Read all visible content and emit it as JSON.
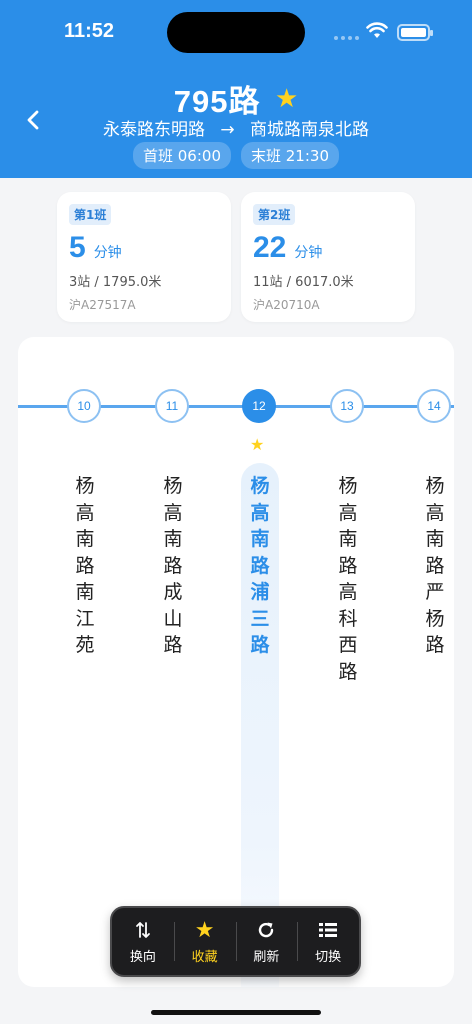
{
  "status": {
    "time": "11:52"
  },
  "header": {
    "route": "795路",
    "origin": "永泰路东明路",
    "arrow": "→",
    "destination": "商城路南泉北路",
    "first_bus": "首班 06:00",
    "last_bus": "末班 21:30"
  },
  "arrivals": [
    {
      "badge": "第1班",
      "eta": "5",
      "unit": "分钟",
      "distance": "3站 / 1795.0米",
      "plate": "沪A27517A"
    },
    {
      "badge": "第2班",
      "eta": "22",
      "unit": "分钟",
      "distance": "11站 / 6017.0米",
      "plate": "沪A20710A"
    }
  ],
  "stations": [
    {
      "num": "10",
      "name": "杨高南路南江苑"
    },
    {
      "num": "11",
      "name": "杨高南路成山路"
    },
    {
      "num": "12",
      "name": "杨高南路浦三路",
      "current": true
    },
    {
      "num": "13",
      "name": "杨高南路高科西路"
    },
    {
      "num": "14",
      "name": "杨高南路严杨路"
    }
  ],
  "toolbar": {
    "reverse": "换向",
    "favorite": "收藏",
    "refresh": "刷新",
    "switch": "切换"
  },
  "colors": {
    "accent": "#2b8ee8",
    "star": "#ffd21f"
  },
  "icons": [
    "back-arrow-icon",
    "star-icon",
    "swap-vertical-icon",
    "refresh-icon",
    "list-icon",
    "wifi-icon",
    "battery-icon"
  ]
}
